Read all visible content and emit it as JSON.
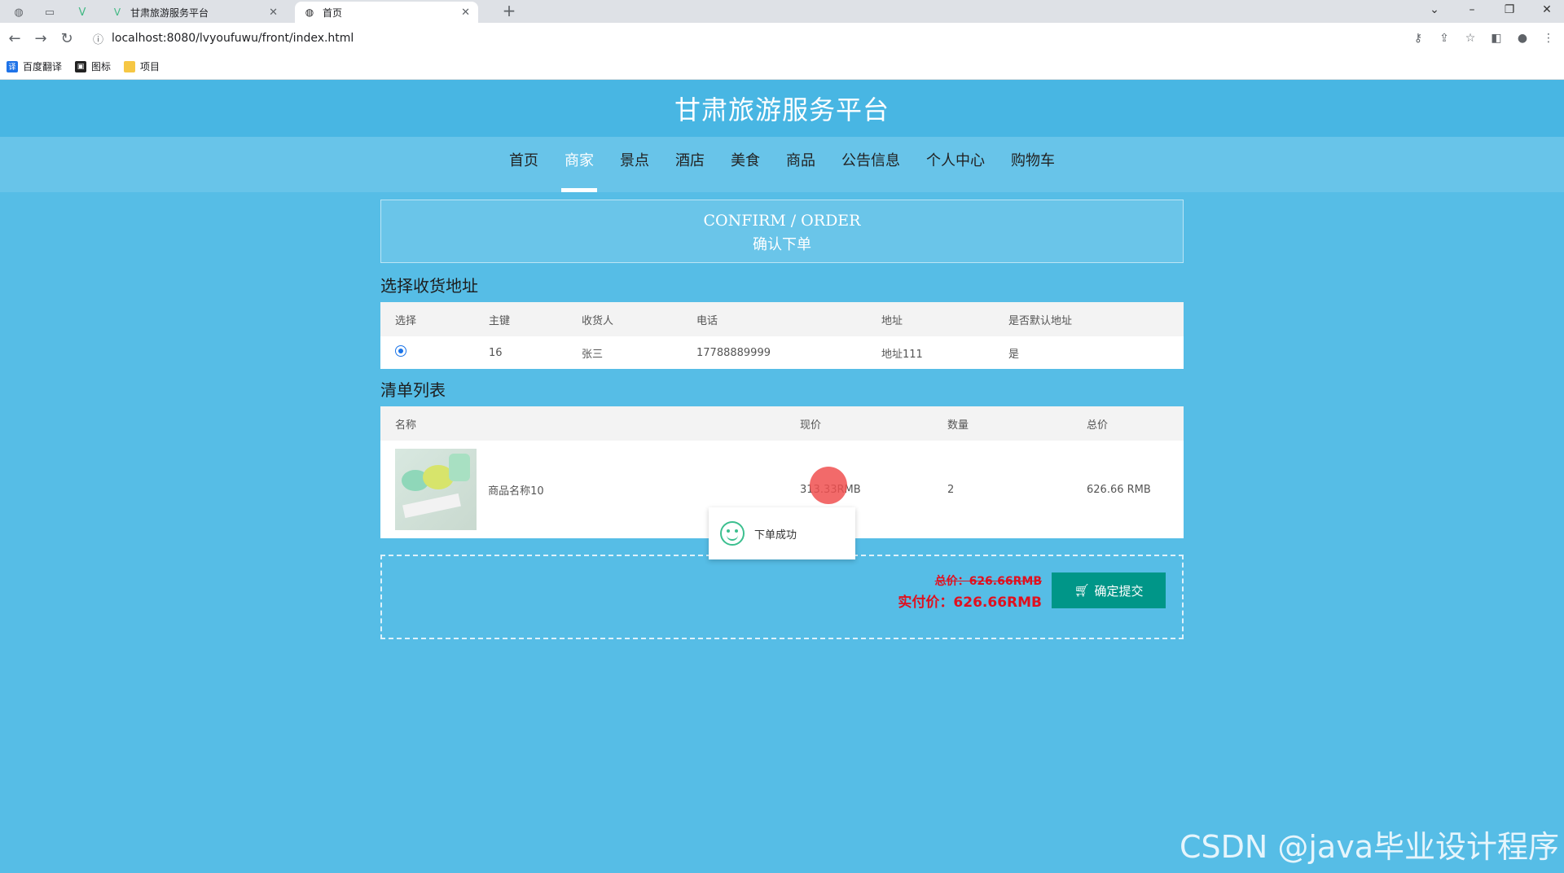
{
  "browser": {
    "tabs": [
      {
        "title": "甘肃旅游服务平台",
        "icon": "vue-icon",
        "active": false
      },
      {
        "title": "首页",
        "icon": "globe-icon",
        "active": true
      }
    ],
    "url": "localhost:8080/lvyoufuwu/front/index.html",
    "bookmarks": [
      {
        "label": "百度翻译",
        "icon": "translate-icon",
        "color": "#1e73e8"
      },
      {
        "label": "图标",
        "icon": "image-icon",
        "color": "#222222"
      },
      {
        "label": "项目",
        "icon": "folder-icon",
        "color": "#f6c744"
      }
    ]
  },
  "site": {
    "title": "甘肃旅游服务平台",
    "nav": [
      {
        "label": "首页"
      },
      {
        "label": "商家",
        "active": true
      },
      {
        "label": "景点"
      },
      {
        "label": "酒店"
      },
      {
        "label": "美食"
      },
      {
        "label": "商品"
      },
      {
        "label": "公告信息"
      },
      {
        "label": "个人中心"
      },
      {
        "label": "购物车"
      }
    ]
  },
  "order": {
    "title_en": "CONFIRM / ORDER",
    "title_cn": "确认下单",
    "address_section": "选择收货地址",
    "address_headers": [
      "选择",
      "主键",
      "收货人",
      "电话",
      "地址",
      "是否默认地址"
    ],
    "address_rows": [
      {
        "id": "16",
        "name": "张三",
        "phone": "17788889999",
        "address": "地址111",
        "default": "是"
      }
    ],
    "list_section": "清单列表",
    "list_headers": [
      "名称",
      "现价",
      "数量",
      "总价"
    ],
    "list_rows": [
      {
        "name": "商品名称10",
        "price": "313.33RMB",
        "qty": "2",
        "total": "626.66 RMB"
      }
    ],
    "total_label": "总价：626.66RMB",
    "paid_label": "实付价：626.66RMB",
    "submit_label": "确定提交"
  },
  "toast": {
    "message": "下单成功"
  },
  "watermark": "CSDN @java毕业设计程序"
}
